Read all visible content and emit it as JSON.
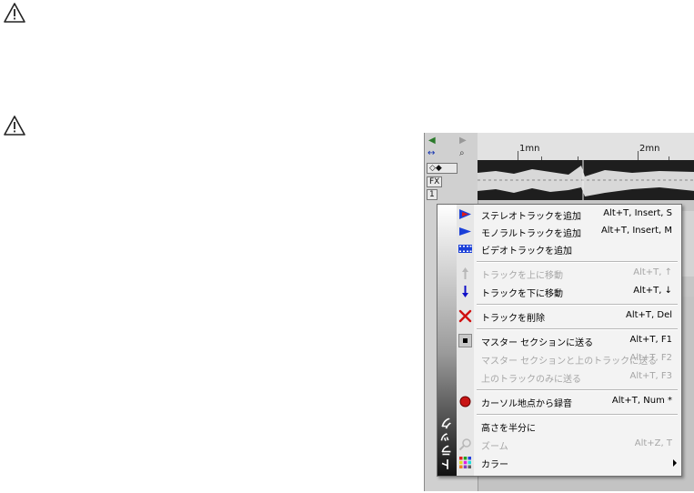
{
  "colors": {
    "menu_bg": "#f3f3f3",
    "disabled_text": "#a6a6a6",
    "delete_red": "#d01010",
    "record_red": "#c81414",
    "move_blue": "#1010c8"
  },
  "warnings": [
    {
      "icon": "warning-icon"
    },
    {
      "icon": "warning-icon"
    }
  ],
  "app": {
    "ruler": {
      "marks": [
        "1mn",
        "2mn"
      ]
    },
    "track_controls": {
      "fx": "FX",
      "number": "1"
    }
  },
  "menu": {
    "side_label": "トラック",
    "items": [
      {
        "label": "ステレオトラックを追加",
        "shortcut": "Alt+T, Insert, S",
        "icon": "stereo-track-icon"
      },
      {
        "label": "モノラルトラックを追加",
        "shortcut": "Alt+T, Insert, M",
        "icon": "mono-track-icon"
      },
      {
        "label": "ビデオトラックを追加",
        "shortcut": "",
        "icon": "video-track-icon"
      },
      {
        "label": "トラックを上に移動",
        "shortcut": "Alt+T, ↑",
        "icon": "arrow-up-icon"
      },
      {
        "label": "トラックを下に移動",
        "shortcut": "Alt+T, ↓",
        "icon": "arrow-down-icon"
      },
      {
        "label": "トラックを削除",
        "shortcut": "Alt+T, Del",
        "icon": "delete-icon"
      },
      {
        "label": "マスター セクションに送る",
        "shortcut": "Alt+T, F1",
        "icon": "master-section-icon"
      },
      {
        "label": "マスター セクションと上のトラックに送る",
        "shortcut": "Alt+T, F2",
        "icon": ""
      },
      {
        "label": "上のトラックのみに送る",
        "shortcut": "Alt+T, F3",
        "icon": ""
      },
      {
        "label": "カーソル地点から録音",
        "shortcut": "Alt+T, Num *",
        "icon": "record-icon"
      },
      {
        "label": "高さを半分に",
        "shortcut": "",
        "icon": ""
      },
      {
        "label": "ズーム",
        "shortcut": "Alt+Z, T",
        "icon": "zoom-icon"
      },
      {
        "label": "カラー",
        "shortcut": "",
        "icon": "color-palette-icon"
      }
    ]
  }
}
